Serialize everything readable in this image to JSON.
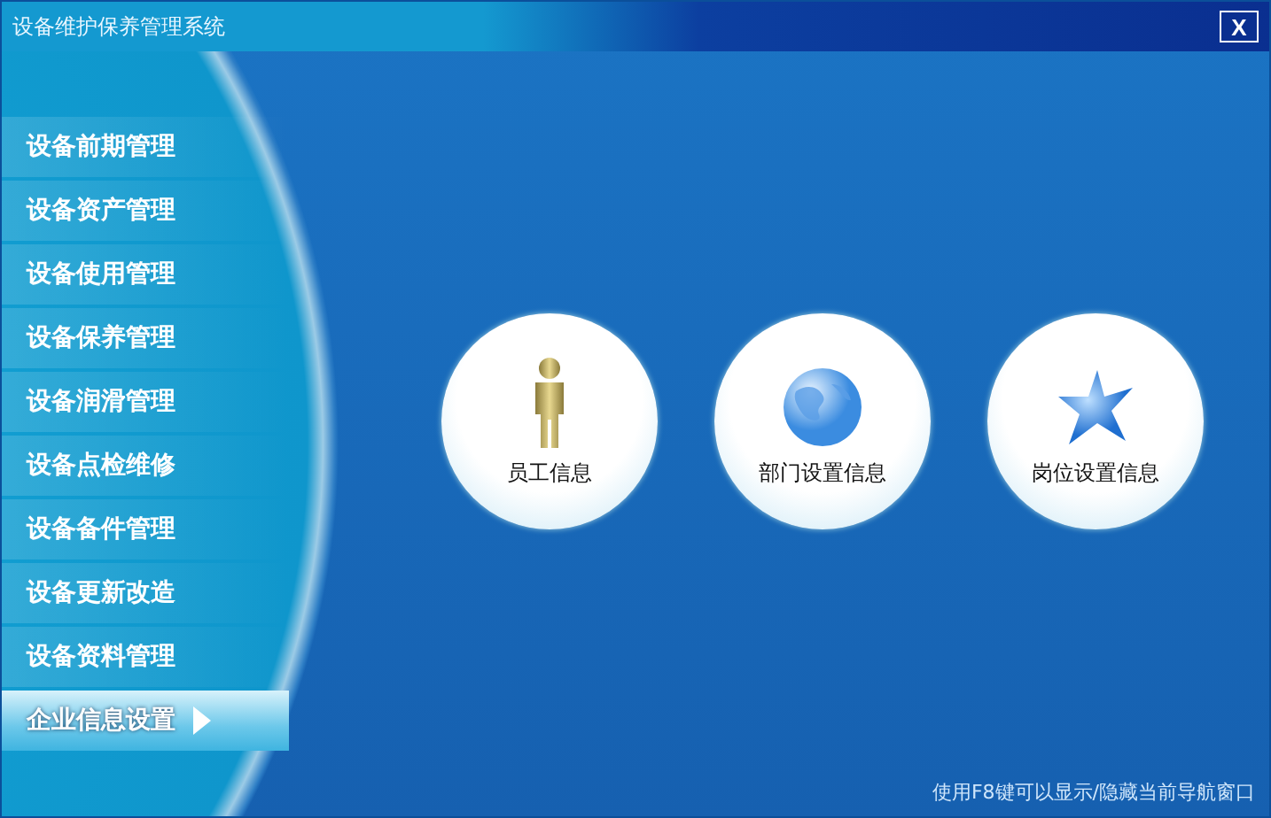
{
  "window": {
    "title": "设备维护保养管理系统",
    "close": "X"
  },
  "sidebar": {
    "items": [
      {
        "label": "设备前期管理",
        "selected": false
      },
      {
        "label": "设备资产管理",
        "selected": false
      },
      {
        "label": "设备使用管理",
        "selected": false
      },
      {
        "label": "设备保养管理",
        "selected": false
      },
      {
        "label": "设备润滑管理",
        "selected": false
      },
      {
        "label": "设备点检维修",
        "selected": false
      },
      {
        "label": "设备备件管理",
        "selected": false
      },
      {
        "label": "设备更新改造",
        "selected": false
      },
      {
        "label": "设备资料管理",
        "selected": false
      },
      {
        "label": "企业信息设置",
        "selected": true
      }
    ]
  },
  "tiles": [
    {
      "label": "员工信息",
      "kind": "person"
    },
    {
      "label": "部门设置信息",
      "kind": "globe"
    },
    {
      "label": "岗位设置信息",
      "kind": "star"
    }
  ],
  "status_bar": {
    "hint": "使用F8键可以显示/隐藏当前导航窗口"
  }
}
